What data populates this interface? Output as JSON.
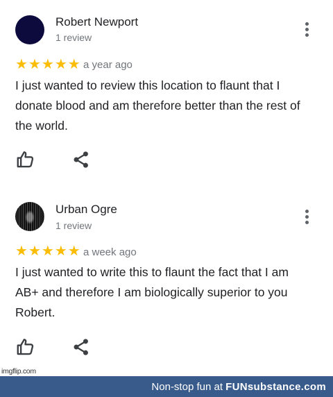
{
  "reviews": [
    {
      "name": "Robert Newport",
      "count": "1 review",
      "rating": 5,
      "time": "a year ago",
      "text": "I just wanted to review this location to flaunt that I donate blood and am therefore better than the rest of the world."
    },
    {
      "name": "Urban Ogre",
      "count": "1 review",
      "rating": 5,
      "time": "a week ago",
      "text": "I just wanted to write this to flaunt the fact that I am AB+ and therefore I am biologically superior to you Robert."
    }
  ],
  "icons": {
    "like": "thumbs-up-icon",
    "share": "share-icon",
    "more": "more-vert-icon",
    "star": "star-icon"
  },
  "colors": {
    "star": "#fbbc04",
    "secondary_text": "#70757a",
    "footer_bg": "#395b8c",
    "avatar_1": "#0d0b3d"
  },
  "watermark": "imgflip.com",
  "footer": {
    "tagline": "Non-stop fun at ",
    "brand": "FUNsubstance.com"
  }
}
